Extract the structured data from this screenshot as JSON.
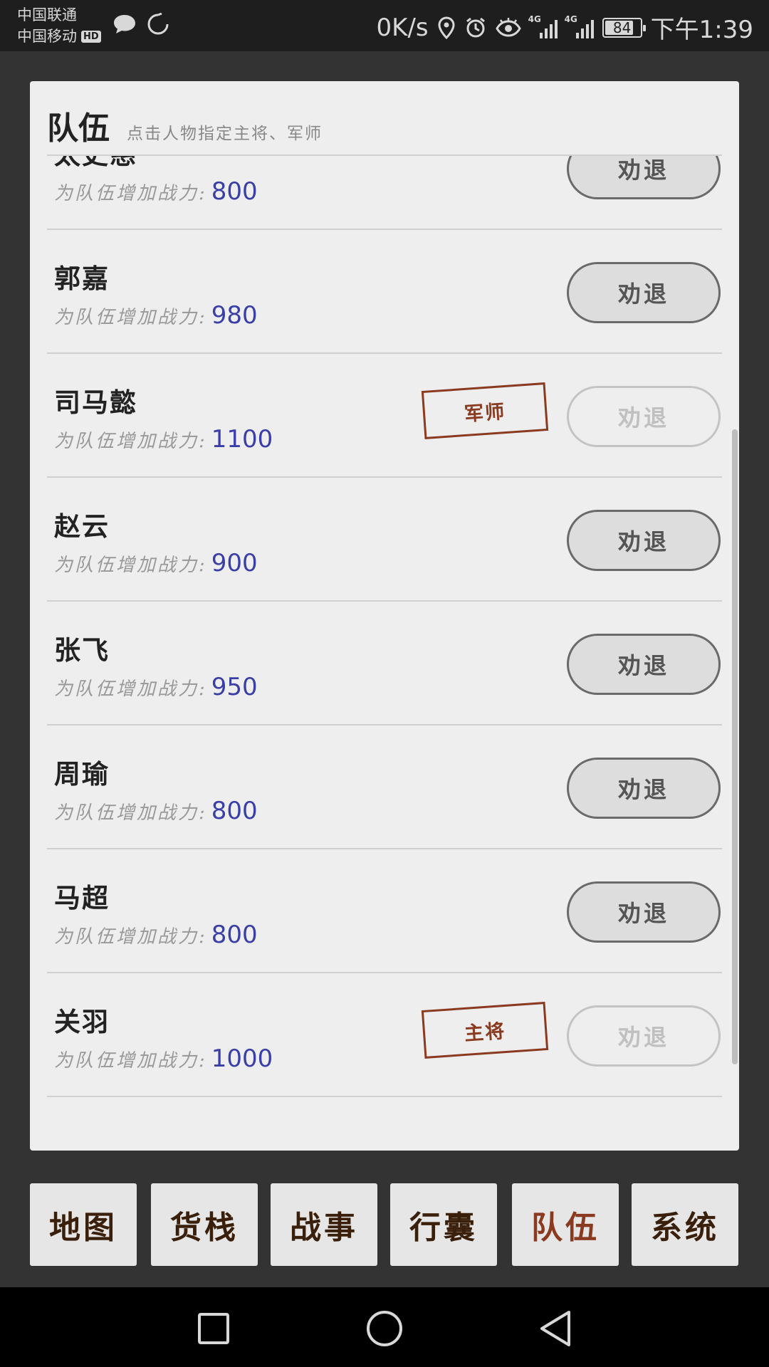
{
  "status_bar": {
    "carrier_1": "中国联通",
    "carrier_2": "中国移动",
    "hd_badge": "HD",
    "net_speed": "0K/s",
    "signal_1_tag": "4G",
    "signal_2_tag": "4G",
    "battery_level": "84",
    "time": "下午1:39"
  },
  "panel": {
    "title": "队伍",
    "subtitle": "点击人物指定主将、军师"
  },
  "stat_label": "为队伍增加战力:",
  "dismiss_label": "劝退",
  "members": [
    {
      "name": "太史慈",
      "power": "800",
      "role": "",
      "dismiss_enabled": true
    },
    {
      "name": "郭嘉",
      "power": "980",
      "role": "",
      "dismiss_enabled": true
    },
    {
      "name": "司马懿",
      "power": "1100",
      "role": "军师",
      "dismiss_enabled": false
    },
    {
      "name": "赵云",
      "power": "900",
      "role": "",
      "dismiss_enabled": true
    },
    {
      "name": "张飞",
      "power": "950",
      "role": "",
      "dismiss_enabled": true
    },
    {
      "name": "周瑜",
      "power": "800",
      "role": "",
      "dismiss_enabled": true
    },
    {
      "name": "马超",
      "power": "800",
      "role": "",
      "dismiss_enabled": true
    },
    {
      "name": "关羽",
      "power": "1000",
      "role": "主将",
      "dismiss_enabled": false
    }
  ],
  "tabs": [
    {
      "label": "地图",
      "active": false
    },
    {
      "label": "货栈",
      "active": false
    },
    {
      "label": "战事",
      "active": false
    },
    {
      "label": "行囊",
      "active": false
    },
    {
      "label": "队伍",
      "active": true
    },
    {
      "label": "系统",
      "active": false
    }
  ],
  "colors": {
    "accent": "#8a3a1e",
    "power_value": "#3a3fa8",
    "tab_text": "#3a1f0a"
  }
}
